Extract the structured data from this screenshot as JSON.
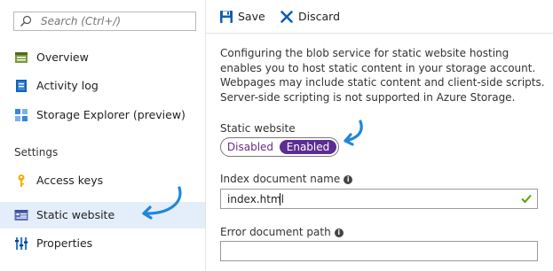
{
  "search": {
    "placeholder": "Search (Ctrl+/)"
  },
  "sidebar": {
    "items": [
      {
        "label": "Overview"
      },
      {
        "label": "Activity log"
      },
      {
        "label": "Storage Explorer (preview)"
      }
    ],
    "section_title": "Settings",
    "settings_items": [
      {
        "label": "Access keys"
      },
      {
        "label": "Static website"
      },
      {
        "label": "Properties"
      }
    ]
  },
  "toolbar": {
    "save_label": "Save",
    "discard_label": "Discard"
  },
  "main": {
    "description": "Configuring the blob service for static website hosting enables you to host static content in your storage account. Webpages may include static content and client-side scripts. Server-side scripting is not supported in Azure Storage.",
    "static_website": {
      "label": "Static website",
      "options": [
        "Disabled",
        "Enabled"
      ],
      "selected": "Enabled"
    },
    "index_document": {
      "label": "Index document name",
      "value": "index.html"
    },
    "error_document": {
      "label": "Error document path",
      "value": ""
    }
  },
  "colors": {
    "accent": "#5c2d91",
    "link_blue": "#0072c6",
    "active_bg": "#e3eefa",
    "annotation_arrow": "#1e88d6",
    "valid_check": "#57a300"
  },
  "icons": {
    "search": "search-icon",
    "overview": "overview-icon",
    "activity_log": "activity-log-icon",
    "storage_explorer": "storage-explorer-icon",
    "access_keys": "key-icon",
    "static_website": "static-website-icon",
    "properties": "properties-icon",
    "save": "save-icon",
    "discard": "discard-icon",
    "info": "info-icon",
    "valid": "checkmark-icon"
  }
}
